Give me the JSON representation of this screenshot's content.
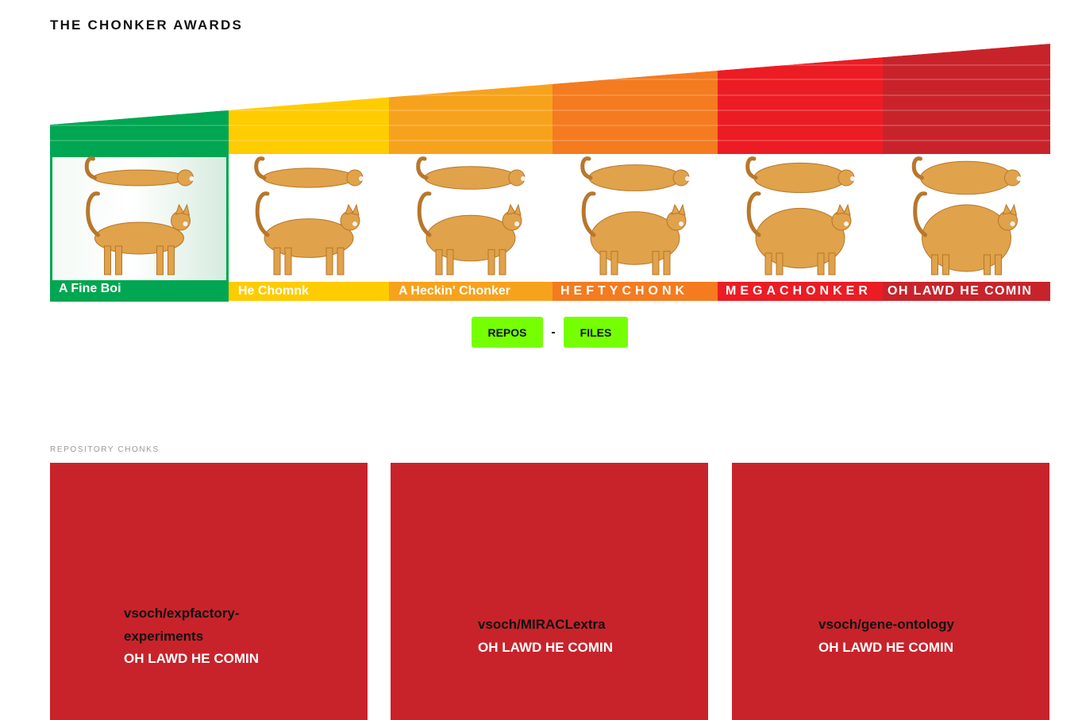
{
  "title": "THE CHONKER AWARDS",
  "chonk_scale": {
    "categories": [
      {
        "label": "A Fine Boi",
        "color": "#00a651",
        "selected": true
      },
      {
        "label": "He Chomnk",
        "color": "#ffcc00"
      },
      {
        "label": "A Heckin' Chonker",
        "color": "#f7a21c"
      },
      {
        "label": "HEFTYCHONK",
        "color": "#f47b20"
      },
      {
        "label": "MEGACHONKER",
        "color": "#ec1c24"
      },
      {
        "label": "OH LAWD HE COMIN",
        "color": "#c8232b"
      }
    ],
    "cat_icon": "chonky-cat-icon"
  },
  "toggle": {
    "repos_label": "REPOS",
    "separator": "-",
    "files_label": "FILES",
    "button_color": "#76ff03"
  },
  "section": {
    "label": "REPOSITORY CHONKS"
  },
  "cards": [
    {
      "repo": "vsoch/expfactory-experiments",
      "rank": "OH LAWD HE COMIN"
    },
    {
      "repo": "vsoch/MIRACLextra",
      "rank": "OH LAWD HE COMIN"
    },
    {
      "repo": "vsoch/gene-ontology",
      "rank": "OH LAWD HE COMIN"
    }
  ],
  "card_color": "#c8232b"
}
